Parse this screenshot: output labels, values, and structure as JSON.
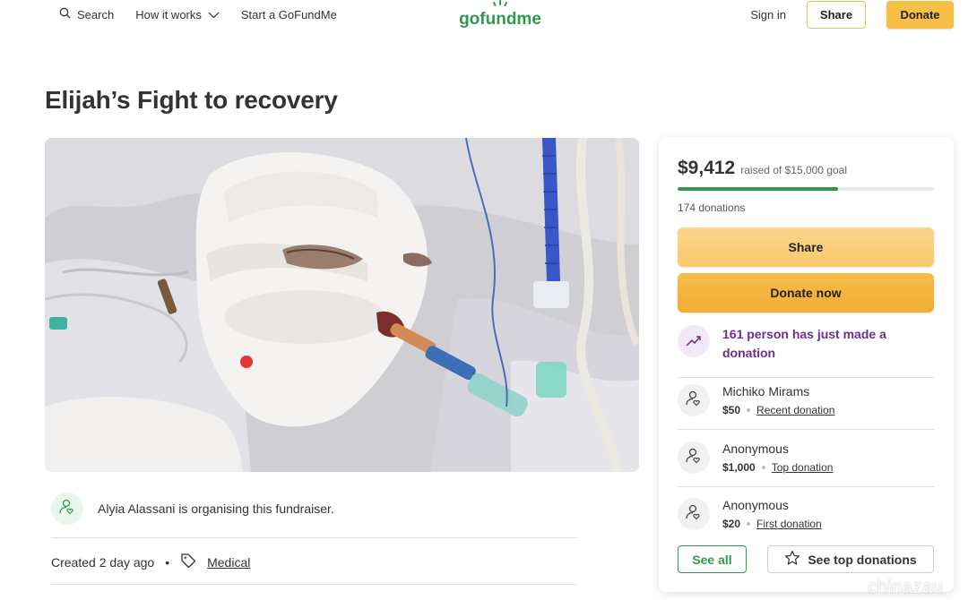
{
  "header": {
    "search_label": "Search",
    "how_it_works_label": "How it works",
    "start_label": "Start a GoFundMe",
    "logo_text": "gofundme",
    "signin_label": "Sign in",
    "share_label": "Share",
    "donate_label": "Donate"
  },
  "campaign": {
    "title": "Elijah’s Fight to recovery",
    "organiser_text": "Alyia Alassani is organising this fundraiser.",
    "created_text": "Created 2 day ago",
    "bullet": "•",
    "category": "Medical"
  },
  "card": {
    "amount": "$9,412",
    "goal_text": "raised of $15,000 goal",
    "progress_fraction": 0.627,
    "donations_count": "174 donations",
    "share_label": "Share",
    "donate_label": "Donate now",
    "trend_text": "161 person has just made a donation",
    "donors": [
      {
        "name": "Michiko Mirams",
        "amount": "$50",
        "type": "Recent donation"
      },
      {
        "name": "Anonymous",
        "amount": "$1,000",
        "type": "Top donation"
      },
      {
        "name": "Anonymous",
        "amount": "$20",
        "type": "First donation"
      }
    ],
    "see_all_label": "See all",
    "see_top_label": "See top donations"
  },
  "colors": {
    "brand_green": "#2f9a4c",
    "donate_yellow": "#f7bf46",
    "trend_purple": "#6d2e8e"
  },
  "watermark": "chinazau"
}
